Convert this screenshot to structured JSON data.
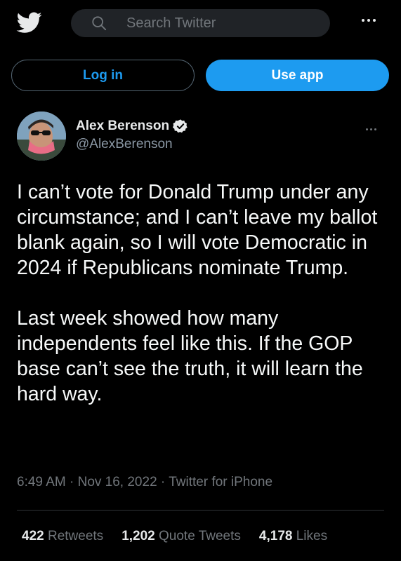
{
  "header": {
    "logo_icon": "twitter-bird-icon",
    "search_placeholder": "Search Twitter",
    "more_icon": "more-horizontal-icon"
  },
  "auth": {
    "login_label": "Log in",
    "use_app_label": "Use app"
  },
  "tweet": {
    "author_name": "Alex Berenson",
    "author_handle": "@AlexBerenson",
    "verified_icon": "verified-badge-icon",
    "text": "I can’t vote for Donald Trump under any circumstance; and I can’t leave my ballot blank again, so I will vote Democratic in 2024 if Republicans nominate Trump.\n\nLast week showed how many independents feel like this. If the GOP base can’t see the truth, it will learn the hard way.",
    "time": "6:49 AM",
    "date": "Nov 16, 2022",
    "source": "Twitter for iPhone",
    "stats": [
      {
        "count": "422",
        "label": "Retweets"
      },
      {
        "count": "1,202",
        "label": "Quote Tweets"
      },
      {
        "count": "4,178",
        "label": "Likes"
      }
    ]
  },
  "colors": {
    "accent": "#1d9bf0",
    "background": "#000000",
    "muted": "#71767b"
  }
}
